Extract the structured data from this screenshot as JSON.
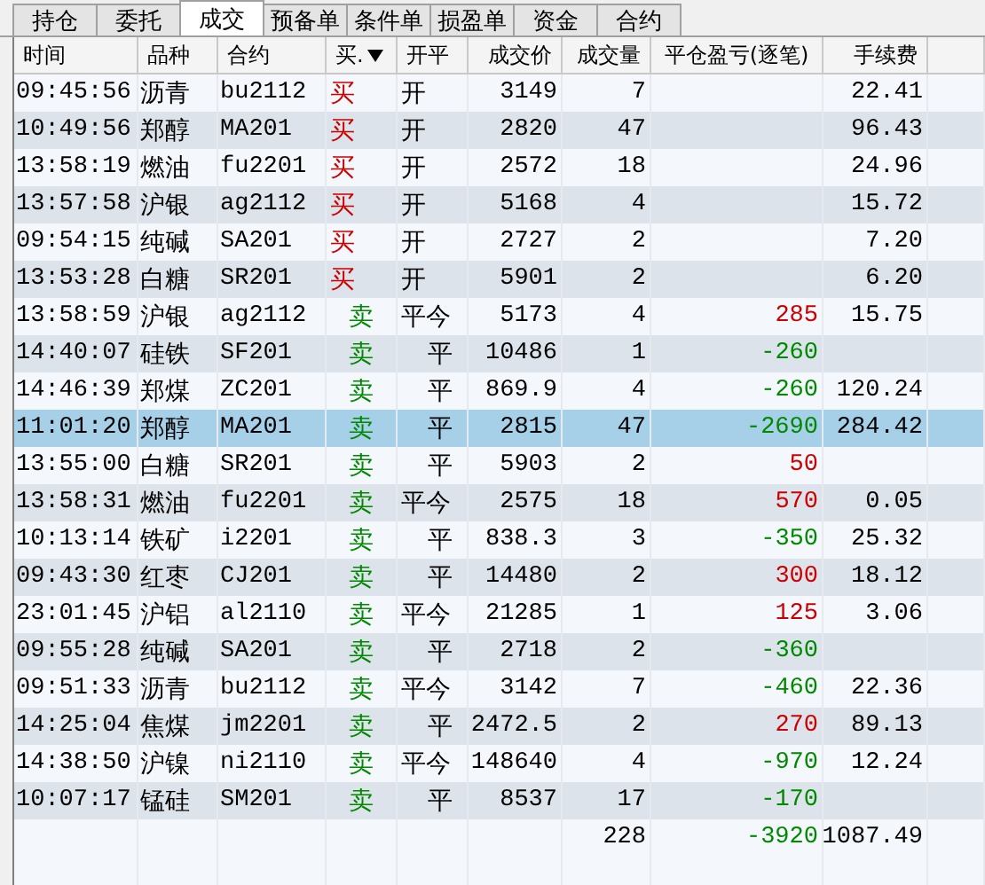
{
  "tabs": [
    {
      "label": "持仓",
      "selected": false
    },
    {
      "label": "委托",
      "selected": false
    },
    {
      "label": "成交",
      "selected": true
    },
    {
      "label": "预备单",
      "selected": false
    },
    {
      "label": "条件单",
      "selected": false
    },
    {
      "label": "损盈单",
      "selected": false
    },
    {
      "label": "资金",
      "selected": false
    },
    {
      "label": "合约",
      "selected": false
    }
  ],
  "table": {
    "columns": [
      {
        "label": "时间",
        "sorted": false
      },
      {
        "label": "品种",
        "sorted": false
      },
      {
        "label": "合约",
        "sorted": false
      },
      {
        "label": "买.",
        "sorted": true
      },
      {
        "label": "开平",
        "sorted": false
      },
      {
        "label": "成交价",
        "sorted": false
      },
      {
        "label": "成交量",
        "sorted": false
      },
      {
        "label": "平仓盈亏(逐笔)",
        "sorted": false
      },
      {
        "label": "手续费",
        "sorted": false
      }
    ],
    "rows": [
      {
        "kind": "buy_open",
        "time": "09:45:56",
        "product": "沥青",
        "contract": "bu2112",
        "side": "买",
        "offset": "开",
        "price": "3149",
        "volume": "7",
        "fee": "22.41",
        "selected": false
      },
      {
        "kind": "buy_open",
        "time": "10:49:56",
        "product": "郑醇",
        "contract": "MA201",
        "side": "买",
        "offset": "开",
        "price": "2820",
        "volume": "47",
        "fee": "96.43",
        "selected": false
      },
      {
        "kind": "buy_open",
        "time": "13:58:19",
        "product": "燃油",
        "contract": "fu2201",
        "side": "买",
        "offset": "开",
        "price": "2572",
        "volume": "18",
        "fee": "24.96",
        "selected": false
      },
      {
        "kind": "buy_open",
        "time": "13:57:58",
        "product": "沪银",
        "contract": "ag2112",
        "side": "买",
        "offset": "开",
        "price": "5168",
        "volume": "4",
        "fee": "15.72",
        "selected": false
      },
      {
        "kind": "buy_open",
        "time": "09:54:15",
        "product": "纯碱",
        "contract": "SA201",
        "side": "买",
        "offset": "开",
        "price": "2727",
        "volume": "2",
        "fee": "7.20",
        "selected": false
      },
      {
        "kind": "buy_open",
        "time": "13:53:28",
        "product": "白糖",
        "contract": "SR201",
        "side": "买",
        "offset": "开",
        "price": "5901",
        "volume": "2",
        "fee": "6.20",
        "selected": false
      },
      {
        "kind": "sell_close_today",
        "time": "13:58:59",
        "product": "沪银",
        "contract": "ag2112",
        "side": "卖",
        "offset": "平今",
        "price": "5173",
        "volume": "4",
        "pnl": "285",
        "fee": "15.75",
        "selected": false
      },
      {
        "kind": "sell_close",
        "time": "14:40:07",
        "product": "硅铁",
        "contract": "SF201",
        "side": "卖",
        "offset": "平",
        "price": "10486",
        "volume": "1",
        "pnl": "-260",
        "selected": false
      },
      {
        "kind": "sell_close",
        "time": "14:46:39",
        "product": "郑煤",
        "contract": "ZC201",
        "side": "卖",
        "offset": "平",
        "price": "869.9",
        "volume": "4",
        "pnl": "-260",
        "fee": "120.24",
        "selected": false
      },
      {
        "kind": "sell_close",
        "time": "11:01:20",
        "product": "郑醇",
        "contract": "MA201",
        "side": "卖",
        "offset": "平",
        "price": "2815",
        "volume": "47",
        "pnl": "-2690",
        "fee": "284.42",
        "selected": true
      },
      {
        "kind": "sell_close",
        "time": "13:55:00",
        "product": "白糖",
        "contract": "SR201",
        "side": "卖",
        "offset": "平",
        "price": "5903",
        "volume": "2",
        "pnl": "50",
        "selected": false
      },
      {
        "kind": "sell_close_today",
        "time": "13:58:31",
        "product": "燃油",
        "contract": "fu2201",
        "side": "卖",
        "offset": "平今",
        "price": "2575",
        "volume": "18",
        "pnl": "570",
        "fee": "0.05",
        "selected": false
      },
      {
        "kind": "sell_close",
        "time": "10:13:14",
        "product": "铁矿",
        "contract": "i2201",
        "side": "卖",
        "offset": "平",
        "price": "838.3",
        "volume": "3",
        "pnl": "-350",
        "fee": "25.32",
        "selected": false
      },
      {
        "kind": "sell_close",
        "time": "09:43:30",
        "product": "红枣",
        "contract": "CJ201",
        "side": "卖",
        "offset": "平",
        "price": "14480",
        "volume": "2",
        "pnl": "300",
        "fee": "18.12",
        "selected": false
      },
      {
        "kind": "sell_close_today",
        "time": "23:01:45",
        "product": "沪铝",
        "contract": "al2110",
        "side": "卖",
        "offset": "平今",
        "price": "21285",
        "volume": "1",
        "pnl": "125",
        "fee": "3.06",
        "selected": false
      },
      {
        "kind": "sell_close",
        "time": "09:55:28",
        "product": "纯碱",
        "contract": "SA201",
        "side": "卖",
        "offset": "平",
        "price": "2718",
        "volume": "2",
        "pnl": "-360",
        "selected": false
      },
      {
        "kind": "sell_close_today",
        "time": "09:51:33",
        "product": "沥青",
        "contract": "bu2112",
        "side": "卖",
        "offset": "平今",
        "price": "3142",
        "volume": "7",
        "pnl": "-460",
        "fee": "22.36",
        "selected": false
      },
      {
        "kind": "sell_close",
        "time": "14:25:04",
        "product": "焦煤",
        "contract": "jm2201",
        "side": "卖",
        "offset": "平",
        "price": "2472.5",
        "volume": "2",
        "pnl": "270",
        "fee": "89.13",
        "selected": false
      },
      {
        "kind": "sell_close_today",
        "time": "14:38:50",
        "product": "沪镍",
        "contract": "ni2110",
        "side": "卖",
        "offset": "平今",
        "price": "148640",
        "volume": "4",
        "pnl": "-970",
        "fee": "12.24",
        "selected": false
      },
      {
        "kind": "sell_close",
        "time": "10:07:17",
        "product": "锰硅",
        "contract": "SM201",
        "side": "卖",
        "offset": "平",
        "price": "8537",
        "volume": "17",
        "pnl": "-170",
        "selected": false
      }
    ],
    "totals": {
      "volume": "228",
      "pnl": "-3920",
      "fee": "1087.49"
    }
  }
}
